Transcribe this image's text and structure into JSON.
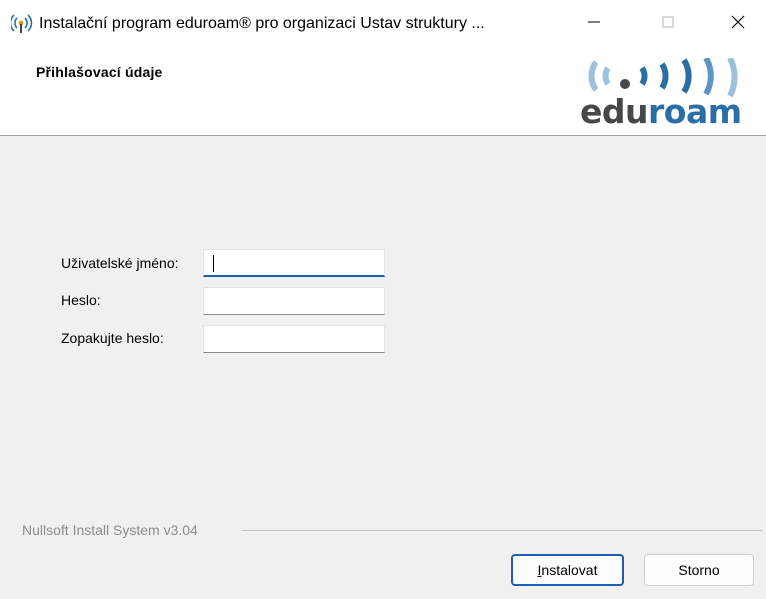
{
  "window": {
    "title": "Instalační program eduroam® pro organizaci Ustav struktury ...",
    "icon": "antenna-icon"
  },
  "header": {
    "title": "Přihlašovací údaje",
    "logo": {
      "part1": "edu",
      "part2": "roam",
      "colors": {
        "dark": "#474747",
        "blue": "#2b6ea6"
      }
    }
  },
  "form": {
    "username_label": "Uživatelské jméno:",
    "username_value": "",
    "password_label": "Heslo:",
    "password_value": "",
    "repeat_label": "Zopakujte heslo:",
    "repeat_value": ""
  },
  "footer": {
    "branding": "Nullsoft Install System v3.04",
    "install_mnemonic": "I",
    "install_rest": "nstalovat",
    "cancel_label": "Storno"
  },
  "colors": {
    "accent": "#1a5fb4",
    "panel": "#f0f0f0"
  }
}
